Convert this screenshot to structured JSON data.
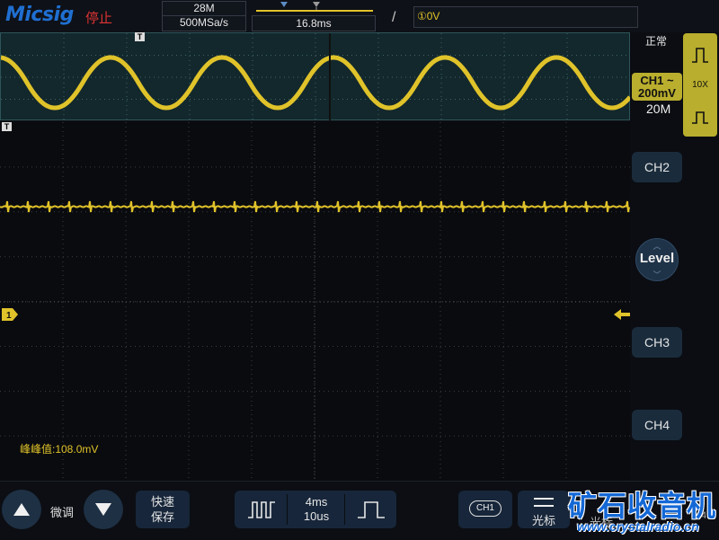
{
  "brand": {
    "logo": "Micsig"
  },
  "status": {
    "run_state": "停止"
  },
  "acquisition": {
    "memory_depth": "28M",
    "sample_rate": "500MSa/s"
  },
  "timebase": {
    "position": "16.8ms"
  },
  "trigger": {
    "slope_icon": "rising-edge-icon",
    "level_display": "①0V"
  },
  "right_panel": {
    "mode": "正常",
    "ch1_label": "CH1",
    "ch1_coupling_icon": "ac-coupling-icon",
    "ch1_scale": "200mV",
    "bandwidth": "20M",
    "probe": "10X",
    "ch2": "CH2",
    "ch3": "CH3",
    "ch4": "CH4",
    "level": "Level"
  },
  "plot": {
    "ch1_marker": "1",
    "trigger_marker": "T",
    "measurement": "峰峰值:108.0mV"
  },
  "bottom": {
    "fine": "微调",
    "quick": "快速",
    "save": "保存",
    "time_main": "4ms",
    "time_zoom": "10us",
    "ch1_chip": "CH1",
    "cursor": "光标",
    "partial_label": "光标",
    "partial_number": "4"
  },
  "watermark": {
    "text": "矿石收音机",
    "url": "www.crystalradio.cn"
  },
  "colors": {
    "ch1": "#e0c32a",
    "accent_blue": "#1f6fd1",
    "probe_panel": "#b9ae2d"
  }
}
